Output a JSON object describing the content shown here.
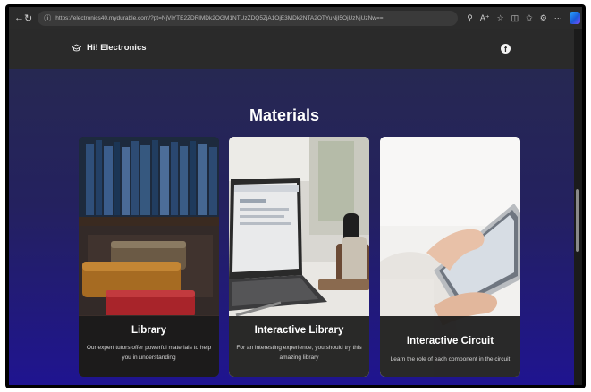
{
  "browser": {
    "url": "https://electronics40.mydurable.com/?pt=NjVlYTE2ZDRlMDk2OGM1NTUzZDQ5ZjA1OjE3MDk2NTA2OTYuNjI5OjUzNjUzNw=="
  },
  "site": {
    "brand": "Hi! Electronics",
    "section_title": "Materials",
    "cards": [
      {
        "title": "Library",
        "description": "Our expert tutors offer powerful materials to help you in understanding"
      },
      {
        "title": "Interactive Library",
        "description": "For an interesting experience, you should try this amazing library"
      },
      {
        "title": "Interactive Circuit",
        "description": "Learn the role of each component in the circuit"
      }
    ]
  },
  "icons": [
    "back-icon",
    "refresh-icon",
    "lock-icon",
    "zoom-icon",
    "read-aloud-icon",
    "favorite-icon",
    "split-screen-icon",
    "favorites-bar-icon",
    "extensions-icon",
    "more-icon",
    "copilot-icon",
    "graduation-cap-icon",
    "facebook-icon"
  ],
  "colors": {
    "page_bg_top": "#272a4e",
    "page_bg_bottom": "#1f1490",
    "header_bg": "#2a2a2a",
    "caption_bg": "#1a1a1a"
  }
}
